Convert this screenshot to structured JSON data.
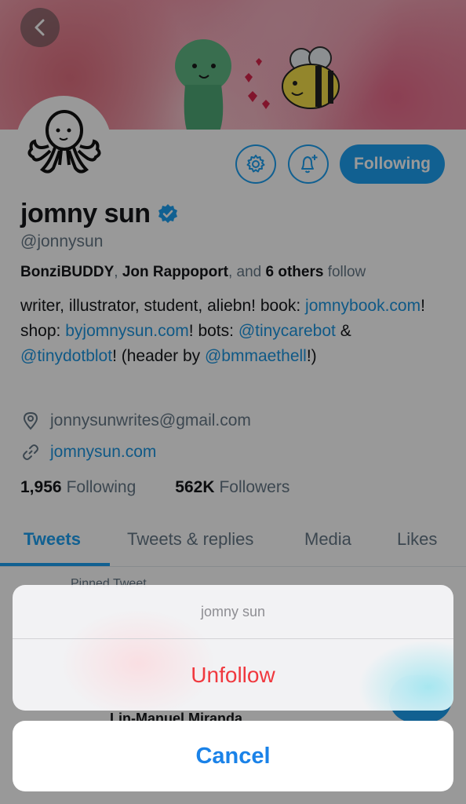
{
  "profile": {
    "name": "jomny sun",
    "handle": "@jonnysun",
    "followed_by": {
      "names": [
        "BonziBUDDY",
        "Jon Rappoport"
      ],
      "sep": ", ",
      "and": ", and ",
      "others": "6 others",
      "suffix": " follow"
    },
    "bio": {
      "t1": "writer, illustrator, student, aliebn! book: ",
      "l1": "jomnybook.com",
      "t2": "! shop: ",
      "l2": "byjomnysun.com",
      "t3": "! bots: ",
      "l3": "@tinycarebot",
      "t4": " & ",
      "l4": "@tinydotblot",
      "t5": "! (header by ",
      "l5": "@bmmaethell",
      "t6": "!)"
    },
    "email": "jonnysunwrites@gmail.com",
    "website": "jomnysun.com",
    "following_count": "1,956",
    "following_label": "Following",
    "followers_count": "562K",
    "followers_label": "Followers"
  },
  "actions": {
    "follow_button": "Following"
  },
  "tabs": [
    "Tweets",
    "Tweets & replies",
    "Media",
    "Likes"
  ],
  "background": {
    "pinned_label": "Pinned Tweet",
    "tweet_name": "Lin-Manuel Miranda"
  },
  "action_sheet": {
    "title": "jomny sun",
    "destructive_action": "Unfollow",
    "cancel": "Cancel"
  },
  "colors": {
    "accent": "#1da1f2",
    "destructive": "#f0383e",
    "cancel": "#1a82e8"
  },
  "icons": [
    "back-arrow-icon",
    "settings-gear-icon",
    "bell-plus-icon",
    "verified-badge-icon",
    "location-pin-icon",
    "link-icon"
  ]
}
